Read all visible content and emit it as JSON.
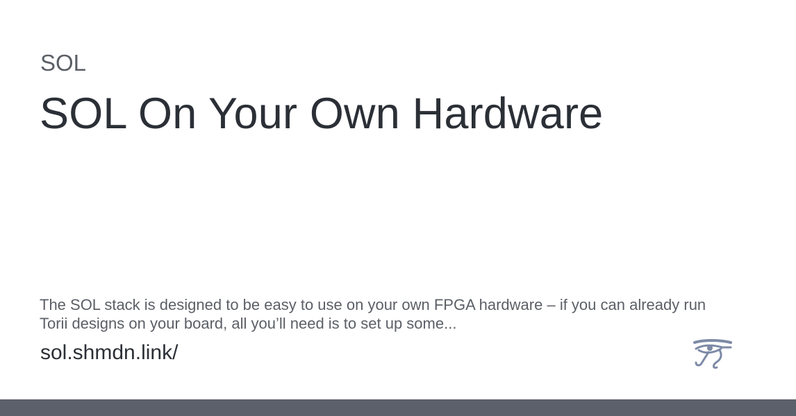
{
  "card": {
    "site_name": "SOL",
    "title": "SOL On Your Own Hardware",
    "description": "The SOL stack is designed to be easy to use on your own FPGA hardware – if you can already run Torii designs on your board, all you’ll need is to set up some...",
    "url": "sol.shmdn.link/",
    "logo_icon": "eye-of-horus-icon"
  },
  "colors": {
    "title_text": "#2b2f36",
    "muted_text": "#5b5f66",
    "logo": "#7d8aa6",
    "bottom_bar": "#5c606a",
    "background": "#ffffff"
  }
}
